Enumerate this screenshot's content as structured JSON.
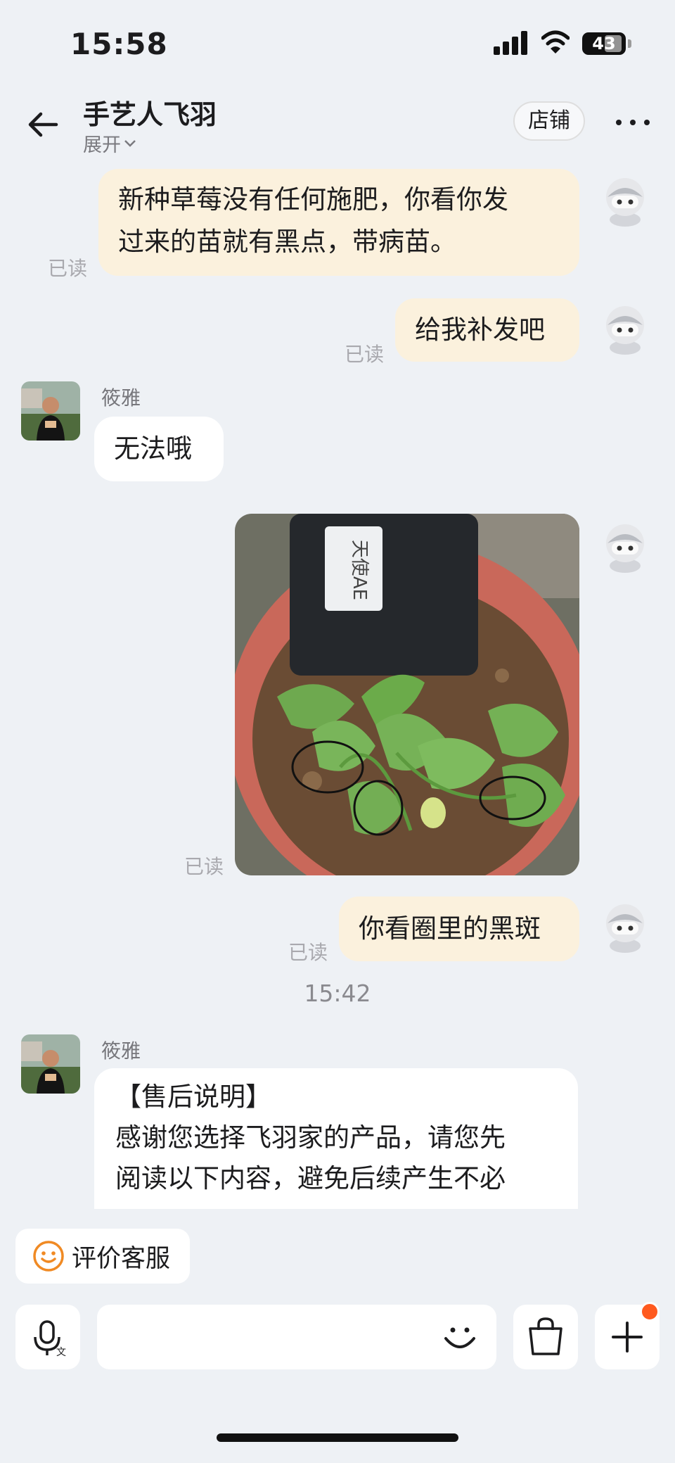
{
  "status_bar": {
    "time": "15:58",
    "battery": "43"
  },
  "header": {
    "title": "手艺人飞羽",
    "expand_label": "展开",
    "store_label": "店铺"
  },
  "messages": {
    "m1": {
      "line1": "新种草莓没有任何施肥，你看你发",
      "line2": "过来的苗就有黑点，带病苗。",
      "read": "已读"
    },
    "m2": {
      "text": "给我补发吧",
      "read": "已读"
    },
    "m3": {
      "sender": "筱雅",
      "text": "无法哦"
    },
    "m4": {
      "photo_label": "天使AE",
      "read": "已读"
    },
    "m5": {
      "text": "你看圈里的黑斑",
      "read": "已读"
    },
    "time_divider": "15:42",
    "m6": {
      "sender": "筱雅",
      "line1": "【售后说明】",
      "line2": "感谢您选择飞羽家的产品，请您先",
      "line3": "阅读以下内容，避免后续产生不必"
    }
  },
  "footer": {
    "eval_label": "评价客服",
    "input_placeholder": "",
    "icons": {
      "voice": "voice-input-icon",
      "emoji": "emoji-icon",
      "bag": "shopping-bag-icon",
      "plus": "plus-icon"
    },
    "accent": "#f08a24",
    "badge_color": "#ff5a1f"
  }
}
